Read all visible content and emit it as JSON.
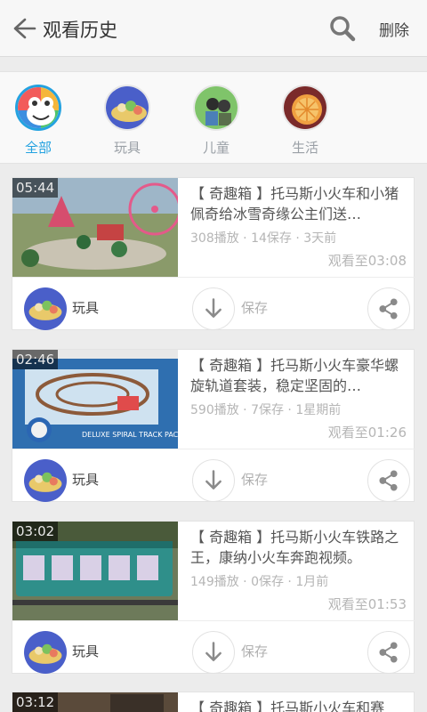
{
  "header": {
    "title": "观看历史",
    "delete_label": "删除"
  },
  "categories": [
    {
      "label": "全部",
      "active": true
    },
    {
      "label": "玩具",
      "active": false
    },
    {
      "label": "儿童",
      "active": false
    },
    {
      "label": "生活",
      "active": false
    }
  ],
  "videos": [
    {
      "duration": "05:44",
      "title": "【 奇趣箱 】托马斯小火车和小猪佩奇给冰雪奇缘公主们送…",
      "meta": "308播放 · 14保存 · 3天前",
      "watched": "观看至03:08",
      "channel": "玩具",
      "save_label": "保存"
    },
    {
      "duration": "02:46",
      "title": "【 奇趣箱 】托马斯小火车豪华螺旋轨道套装，稳定坚固的…",
      "meta": "590播放 · 7保存 · 1星期前",
      "watched": "观看至01:26",
      "channel": "玩具",
      "save_label": "保存",
      "thumb_text": "DELUXE SPIRAL TRACK PACK"
    },
    {
      "duration": "03:02",
      "title": "【 奇趣箱 】托马斯小火车铁路之王，康纳小火车奔跑视频。",
      "meta": "149播放 · 0保存 · 1月前",
      "watched": "观看至01:53",
      "channel": "玩具",
      "save_label": "保存"
    },
    {
      "duration": "03:12",
      "title": "【 奇趣箱 】托马斯小火车和赛"
    }
  ],
  "colors": {
    "accent": "#24a2e0",
    "icon_gray": "#8a8a8a"
  },
  "icons": [
    "back-arrow-icon",
    "search-icon",
    "download-icon",
    "share-icon"
  ]
}
